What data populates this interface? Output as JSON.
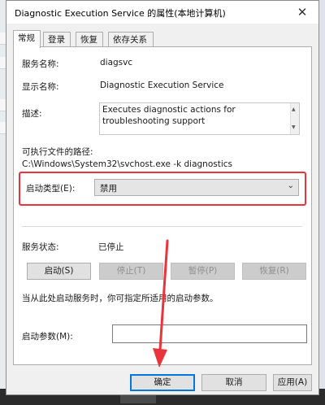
{
  "window": {
    "title": "Diagnostic Execution Service 的属性(本地计算机)",
    "close_glyph": "✕"
  },
  "tabs": [
    {
      "label": "常规",
      "active": true
    },
    {
      "label": "登录",
      "active": false
    },
    {
      "label": "恢复",
      "active": false
    },
    {
      "label": "依存关系",
      "active": false
    }
  ],
  "general": {
    "service_name_label": "服务名称:",
    "service_name": "diagsvc",
    "display_name_label": "显示名称:",
    "display_name": "Diagnostic Execution Service",
    "description_label": "描述:",
    "description": "Executes diagnostic actions for troubleshooting support",
    "path_label": "可执行文件的路径:",
    "path": "C:\\Windows\\System32\\svchost.exe -k diagnostics",
    "startup_type_label": "启动类型(E):",
    "startup_type": "禁用",
    "status_label": "服务状态:",
    "status": "已停止",
    "buttons": {
      "start": "启动(S)",
      "stop": "停止(T)",
      "pause": "暂停(P)",
      "resume": "恢复(R)"
    },
    "hint": "当从此处启动服务时，你可指定所适用的启动参数。",
    "params_label": "启动参数(M):",
    "params_value": ""
  },
  "footer": {
    "ok": "确定",
    "cancel": "取消",
    "apply": "应用(A)"
  },
  "colors": {
    "highlight_border": "#e8343a",
    "annotation_arrow": "#e8343a",
    "default_button_border": "#0078d7"
  },
  "icons": {
    "close": "close-icon",
    "dropdown": "chevron-down-icon"
  }
}
